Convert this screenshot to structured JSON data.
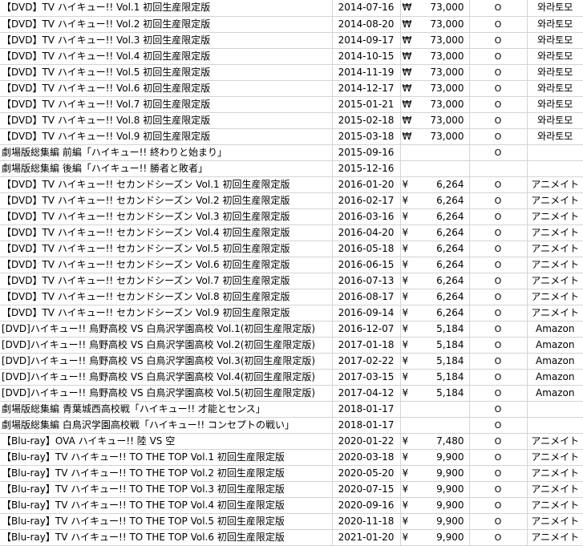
{
  "rows": [
    {
      "title": "【DVD】TV ハイキュー!! Vol.1 初回生産限定版",
      "date": "2014-07-16",
      "currency": "₩",
      "price": "73,000",
      "owned": "O",
      "store": "와라토모"
    },
    {
      "title": "【DVD】TV ハイキュー!! Vol.2 初回生産限定版",
      "date": "2014-08-20",
      "currency": "₩",
      "price": "73,000",
      "owned": "O",
      "store": "와라토모"
    },
    {
      "title": "【DVD】TV ハイキュー!! Vol.3 初回生産限定版",
      "date": "2014-09-17",
      "currency": "₩",
      "price": "73,000",
      "owned": "O",
      "store": "와라토모"
    },
    {
      "title": "【DVD】TV ハイキュー!! Vol.4 初回生産限定版",
      "date": "2014-10-15",
      "currency": "₩",
      "price": "73,000",
      "owned": "O",
      "store": "와라토모"
    },
    {
      "title": "【DVD】TV ハイキュー!! Vol.5 初回生産限定版",
      "date": "2014-11-19",
      "currency": "₩",
      "price": "73,000",
      "owned": "O",
      "store": "와라토모"
    },
    {
      "title": "【DVD】TV ハイキュー!! Vol.6 初回生産限定版",
      "date": "2014-12-17",
      "currency": "₩",
      "price": "73,000",
      "owned": "O",
      "store": "와라토모"
    },
    {
      "title": "【DVD】TV ハイキュー!! Vol.7 初回生産限定版",
      "date": "2015-01-21",
      "currency": "₩",
      "price": "73,000",
      "owned": "O",
      "store": "와라토모"
    },
    {
      "title": "【DVD】TV ハイキュー!! Vol.8 初回生産限定版",
      "date": "2015-02-18",
      "currency": "₩",
      "price": "73,000",
      "owned": "O",
      "store": "와라토모"
    },
    {
      "title": "【DVD】TV ハイキュー!! Vol.9 初回生産限定版",
      "date": "2015-03-18",
      "currency": "₩",
      "price": "73,000",
      "owned": "O",
      "store": "와라토모"
    },
    {
      "title": "劇場版総集編 前編「ハイキュー!! 終わりと始まり」",
      "date": "2015-09-16",
      "currency": "",
      "price": "",
      "owned": "O",
      "store": ""
    },
    {
      "title": "劇場版総集編 後編「ハイキュー!! 勝者と敗者」",
      "date": "2015-12-16",
      "currency": "",
      "price": "",
      "owned": "",
      "store": ""
    },
    {
      "title": "【DVD】TV ハイキュー!! セカンドシーズン Vol.1 初回生産限定版",
      "date": "2016-01-20",
      "currency": "¥",
      "price": "6,264",
      "owned": "O",
      "store": "アニメイト"
    },
    {
      "title": "【DVD】TV ハイキュー!! セカンドシーズン Vol.2 初回生産限定版",
      "date": "2016-02-17",
      "currency": "¥",
      "price": "6,264",
      "owned": "O",
      "store": "アニメイト"
    },
    {
      "title": "【DVD】TV ハイキュー!! セカンドシーズン Vol.3 初回生産限定版",
      "date": "2016-03-16",
      "currency": "¥",
      "price": "6,264",
      "owned": "O",
      "store": "アニメイト"
    },
    {
      "title": "【DVD】TV ハイキュー!! セカンドシーズン Vol.4 初回生産限定版",
      "date": "2016-04-20",
      "currency": "¥",
      "price": "6,264",
      "owned": "O",
      "store": "アニメイト"
    },
    {
      "title": "【DVD】TV ハイキュー!! セカンドシーズン Vol.5 初回生産限定版",
      "date": "2016-05-18",
      "currency": "¥",
      "price": "6,264",
      "owned": "O",
      "store": "アニメイト"
    },
    {
      "title": "【DVD】TV ハイキュー!! セカンドシーズン Vol.6 初回生産限定版",
      "date": "2016-06-15",
      "currency": "¥",
      "price": "6,264",
      "owned": "O",
      "store": "アニメイト"
    },
    {
      "title": "【DVD】TV ハイキュー!! セカンドシーズン Vol.7 初回生産限定版",
      "date": "2016-07-13",
      "currency": "¥",
      "price": "6,264",
      "owned": "O",
      "store": "アニメイト"
    },
    {
      "title": "【DVD】TV ハイキュー!! セカンドシーズン Vol.8 初回生産限定版",
      "date": "2016-08-17",
      "currency": "¥",
      "price": "6,264",
      "owned": "O",
      "store": "アニメイト"
    },
    {
      "title": "【DVD】TV ハイキュー!! セカンドシーズン Vol.9 初回生産限定版",
      "date": "2016-09-14",
      "currency": "¥",
      "price": "6,264",
      "owned": "O",
      "store": "アニメイト"
    },
    {
      "title": "[DVD]ハイキュー!! 烏野高校 VS 白鳥沢学園高校 Vol.1(初回生産限定版)",
      "date": "2016-12-07",
      "currency": "¥",
      "price": "5,184",
      "owned": "O",
      "store": "Amazon"
    },
    {
      "title": "[DVD]ハイキュー!! 烏野高校 VS 白鳥沢学園高校 Vol.2(初回生産限定版)",
      "date": "2017-01-18",
      "currency": "¥",
      "price": "5,184",
      "owned": "O",
      "store": "Amazon"
    },
    {
      "title": "[DVD]ハイキュー!! 烏野高校 VS 白鳥沢学園高校 Vol.3(初回生産限定版)",
      "date": "2017-02-22",
      "currency": "¥",
      "price": "5,184",
      "owned": "O",
      "store": "Amazon"
    },
    {
      "title": "[DVD]ハイキュー!! 烏野高校 VS 白鳥沢学園高校 Vol.4(初回生産限定版)",
      "date": "2017-03-15",
      "currency": "¥",
      "price": "5,184",
      "owned": "O",
      "store": "Amazon"
    },
    {
      "title": "[DVD]ハイキュー!! 烏野高校 VS 白鳥沢学園高校 Vol.5(初回生産限定版)",
      "date": "2017-04-12",
      "currency": "¥",
      "price": "5,184",
      "owned": "O",
      "store": "Amazon"
    },
    {
      "title": "劇場版総集編 青葉城西高校戦「ハイキュー!! 才能とセンス」",
      "date": "2018-01-17",
      "currency": "",
      "price": "",
      "owned": "O",
      "store": ""
    },
    {
      "title": "劇場版総集編 白鳥沢学園高校戦「ハイキュー!! コンセプトの戦い」",
      "date": "2018-01-17",
      "currency": "",
      "price": "",
      "owned": "O",
      "store": ""
    },
    {
      "title": "【Blu-ray】OVA ハイキュー!! 陸 VS 空",
      "date": "2020-01-22",
      "currency": "¥",
      "price": "7,480",
      "owned": "O",
      "store": "アニメイト"
    },
    {
      "title": "【Blu-ray】TV ハイキュー!! TO THE TOP Vol.1 初回生産限定版",
      "date": "2020-03-18",
      "currency": "¥",
      "price": "9,900",
      "owned": "O",
      "store": "アニメイト"
    },
    {
      "title": "【Blu-ray】TV ハイキュー!! TO THE TOP Vol.2 初回生産限定版",
      "date": "2020-05-20",
      "currency": "¥",
      "price": "9,900",
      "owned": "O",
      "store": "アニメイト"
    },
    {
      "title": "【Blu-ray】TV ハイキュー!! TO THE TOP Vol.3 初回生産限定版",
      "date": "2020-07-15",
      "currency": "¥",
      "price": "9,900",
      "owned": "O",
      "store": "アニメイト"
    },
    {
      "title": "【Blu-ray】TV ハイキュー!! TO THE TOP Vol.4 初回生産限定版",
      "date": "2020-09-16",
      "currency": "¥",
      "price": "9,900",
      "owned": "O",
      "store": "アニメイト"
    },
    {
      "title": "【Blu-ray】TV ハイキュー!! TO THE TOP Vol.5 初回生産限定版",
      "date": "2020-11-18",
      "currency": "¥",
      "price": "9,900",
      "owned": "O",
      "store": "アニメイト"
    },
    {
      "title": "【Blu-ray】TV ハイキュー!! TO THE TOP Vol.6 初回生産限定版",
      "date": "2021-01-20",
      "currency": "¥",
      "price": "9,900",
      "owned": "O",
      "store": "アニメイト"
    }
  ]
}
